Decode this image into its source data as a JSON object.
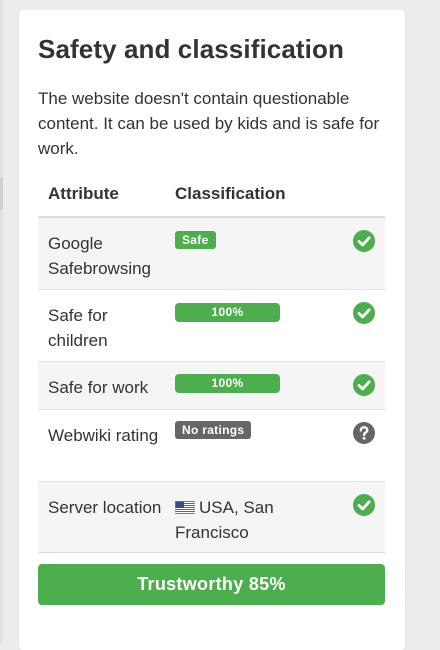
{
  "title": "Safety and classification",
  "description": "The website doesn't contain questionable content. It can be used by kids and is safe for work.",
  "table": {
    "headers": {
      "attribute": "Attribute",
      "classification": "Classification"
    },
    "rows": [
      {
        "attribute": "Google Safebrowsing",
        "badge": "Safe",
        "status_icon": "check-icon"
      },
      {
        "attribute": "Safe for children",
        "badge": "100%",
        "progress": 1.0,
        "status_icon": "check-icon"
      },
      {
        "attribute": "Safe for work",
        "badge": "100%",
        "progress": 1.0,
        "status_icon": "check-icon"
      },
      {
        "attribute": "Webwiki rating",
        "badge": "No ratings",
        "status_icon": "question-icon"
      },
      {
        "attribute": "Server location",
        "value": "USA, San Francisco",
        "flag_icon": "us-flag-icon",
        "status_icon": "check-icon"
      }
    ]
  },
  "trust": {
    "label": "Trustworthy 85%",
    "value": 85
  },
  "colors": {
    "green": "#4cae4c",
    "gray_badge": "#666666",
    "question_icon": "#666666",
    "text": "#333333"
  }
}
